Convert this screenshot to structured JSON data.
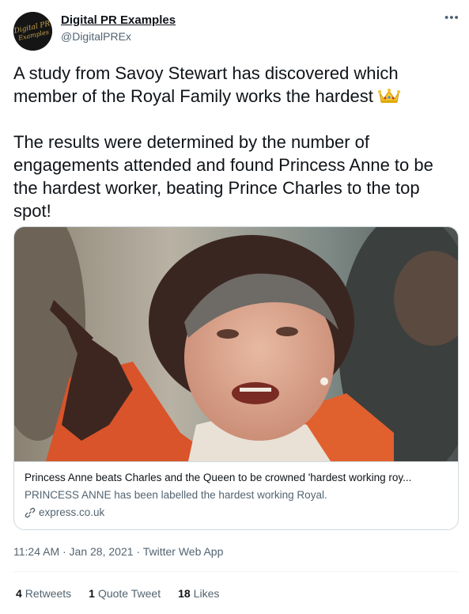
{
  "author": {
    "name": "Digital PR Examples",
    "handle": "@DigitalPREx",
    "avatar_text": "Digital PR Examples"
  },
  "more_icon": "more-horizontal-icon",
  "tweet": {
    "line1": "A study from Savoy Stewart has discovered which member of the Royal Family works the hardest",
    "emoji": "crown-emoji",
    "line2": "The results were determined by the number of engagements attended and found Princess Anne to be the hardest worker, beating Prince Charles to the top spot!"
  },
  "card": {
    "title": "Princess Anne beats Charles and the Queen to be crowned 'hardest working roy...",
    "description": "PRINCESS ANNE has been labelled the hardest working Royal.",
    "domain": "express.co.uk",
    "link_icon": "link-icon"
  },
  "meta": "11:24 AM · Jan 28, 2021 · Twitter Web App",
  "stats": {
    "retweets_count": "4",
    "retweets_label": "Retweets",
    "quotes_count": "1",
    "quotes_label": "Quote Tweet",
    "likes_count": "18",
    "likes_label": "Likes"
  },
  "colors": {
    "text": "#0f1419",
    "secondary": "#536471",
    "border": "#cfd9de",
    "avatar_bg": "#151515",
    "logo_gold": "#c9a24a"
  }
}
